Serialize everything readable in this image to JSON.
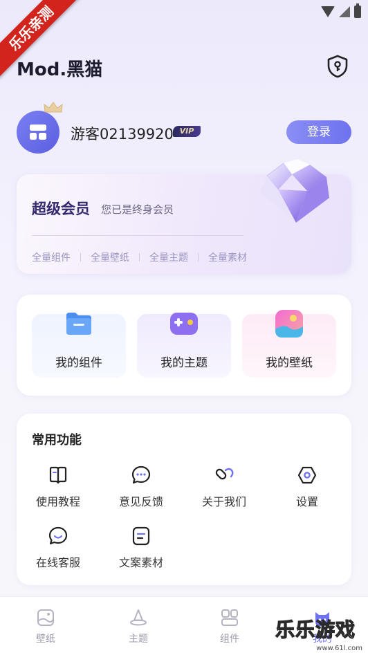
{
  "ribbon": {
    "text": "乐乐亲测"
  },
  "header": {
    "title": "Mod.黑猫",
    "shield_icon": "shield-key-icon"
  },
  "user": {
    "name": "游客02139920",
    "vip_label": "VIP",
    "login_label": "登录"
  },
  "member": {
    "title": "超级会员",
    "subtitle": "您已是终身会员",
    "benefits": [
      "全量组件",
      "全量壁纸",
      "全量主题",
      "全量素材"
    ]
  },
  "mine": {
    "items": [
      {
        "label": "我的组件",
        "icon": "folder-icon"
      },
      {
        "label": "我的主题",
        "icon": "gamepad-icon"
      },
      {
        "label": "我的壁纸",
        "icon": "picture-icon"
      }
    ]
  },
  "functions": {
    "title": "常用功能",
    "items": [
      {
        "label": "使用教程",
        "icon": "book-icon"
      },
      {
        "label": "意见反馈",
        "icon": "chat-bubble-icon"
      },
      {
        "label": "关于我们",
        "icon": "link-icon"
      },
      {
        "label": "设置",
        "icon": "hexagon-settings-icon"
      },
      {
        "label": "在线客服",
        "icon": "smile-chat-icon"
      },
      {
        "label": "文案素材",
        "icon": "document-icon"
      }
    ]
  },
  "nav": {
    "items": [
      {
        "label": "壁纸",
        "icon": "wallpaper-icon"
      },
      {
        "label": "主题",
        "icon": "witch-hat-icon"
      },
      {
        "label": "组件",
        "icon": "grid-icon"
      },
      {
        "label": "我的",
        "icon": "cat-icon"
      }
    ]
  },
  "watermark": {
    "text": "乐乐游戏",
    "url": "www.61l.com"
  },
  "colors": {
    "accent": "#6e72ee",
    "member_title": "#33286e",
    "ribbon": "#d2231c"
  }
}
